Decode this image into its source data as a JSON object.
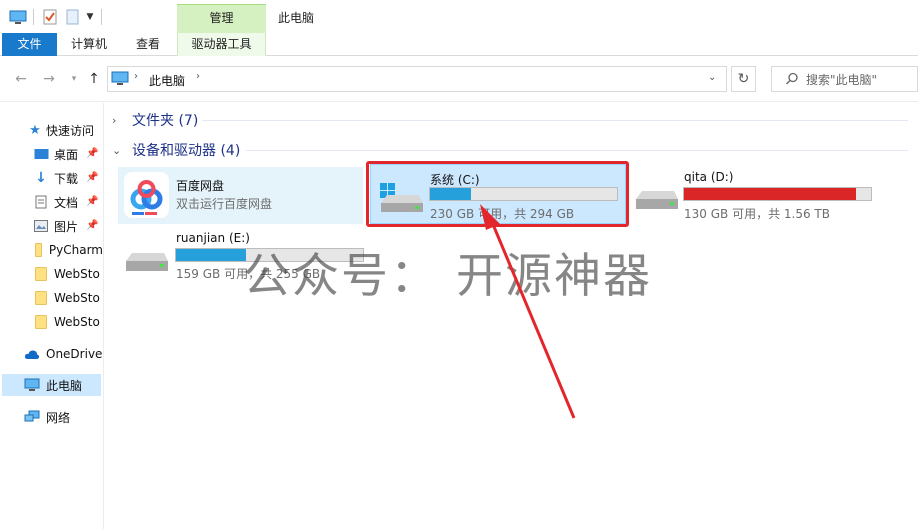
{
  "titlebar": {
    "window_title": "此电脑",
    "contextual_tab": "管理"
  },
  "ribbon": {
    "tabs": [
      "文件",
      "计算机",
      "查看",
      "驱动器工具"
    ]
  },
  "address": {
    "path": [
      "此电脑"
    ]
  },
  "search": {
    "placeholder": "搜索\"此电脑\""
  },
  "sidebar": {
    "quick_access": "快速访问",
    "items": [
      {
        "label": "桌面",
        "icon": "desktop-icon",
        "pinned": true
      },
      {
        "label": "下载",
        "icon": "download-icon",
        "pinned": true
      },
      {
        "label": "文档",
        "icon": "document-icon",
        "pinned": true
      },
      {
        "label": "图片",
        "icon": "picture-icon",
        "pinned": true
      },
      {
        "label": "PyCharm",
        "icon": "folder-icon",
        "pinned": false
      },
      {
        "label": "WebSto",
        "icon": "folder-icon",
        "pinned": false
      },
      {
        "label": "WebSto",
        "icon": "folder-icon",
        "pinned": false
      },
      {
        "label": "WebSto",
        "icon": "folder-icon",
        "pinned": false
      }
    ],
    "onedrive": "OneDrive",
    "this_pc": "此电脑",
    "network": "网络"
  },
  "content": {
    "folders_header": "文件夹 (7)",
    "devices_header": "设备和驱动器 (4)",
    "devices": [
      {
        "name": "百度网盘",
        "subtitle": "双击运行百度网盘",
        "type": "app"
      },
      {
        "name": "系统 (C:)",
        "free": "230 GB 可用，共 294 GB",
        "used_fraction": 0.218,
        "bar_color": "#26a0da",
        "selected": true
      },
      {
        "name": "qita (D:)",
        "free": "130 GB 可用，共 1.56 TB",
        "used_fraction": 0.92,
        "bar_color": "#da2626",
        "selected": false
      },
      {
        "name": "ruanjian (E:)",
        "free": "159 GB 可用，共 255 GB",
        "used_fraction": 0.376,
        "bar_color": "#26a0da",
        "selected": false
      }
    ]
  },
  "watermark": "公众号： 开源神器",
  "colors": {
    "accent": "#1979ca",
    "selection": "#cce8ff",
    "drive_bar_normal": "#26a0da",
    "drive_bar_full": "#da2626",
    "annotation": "#e3262b"
  }
}
